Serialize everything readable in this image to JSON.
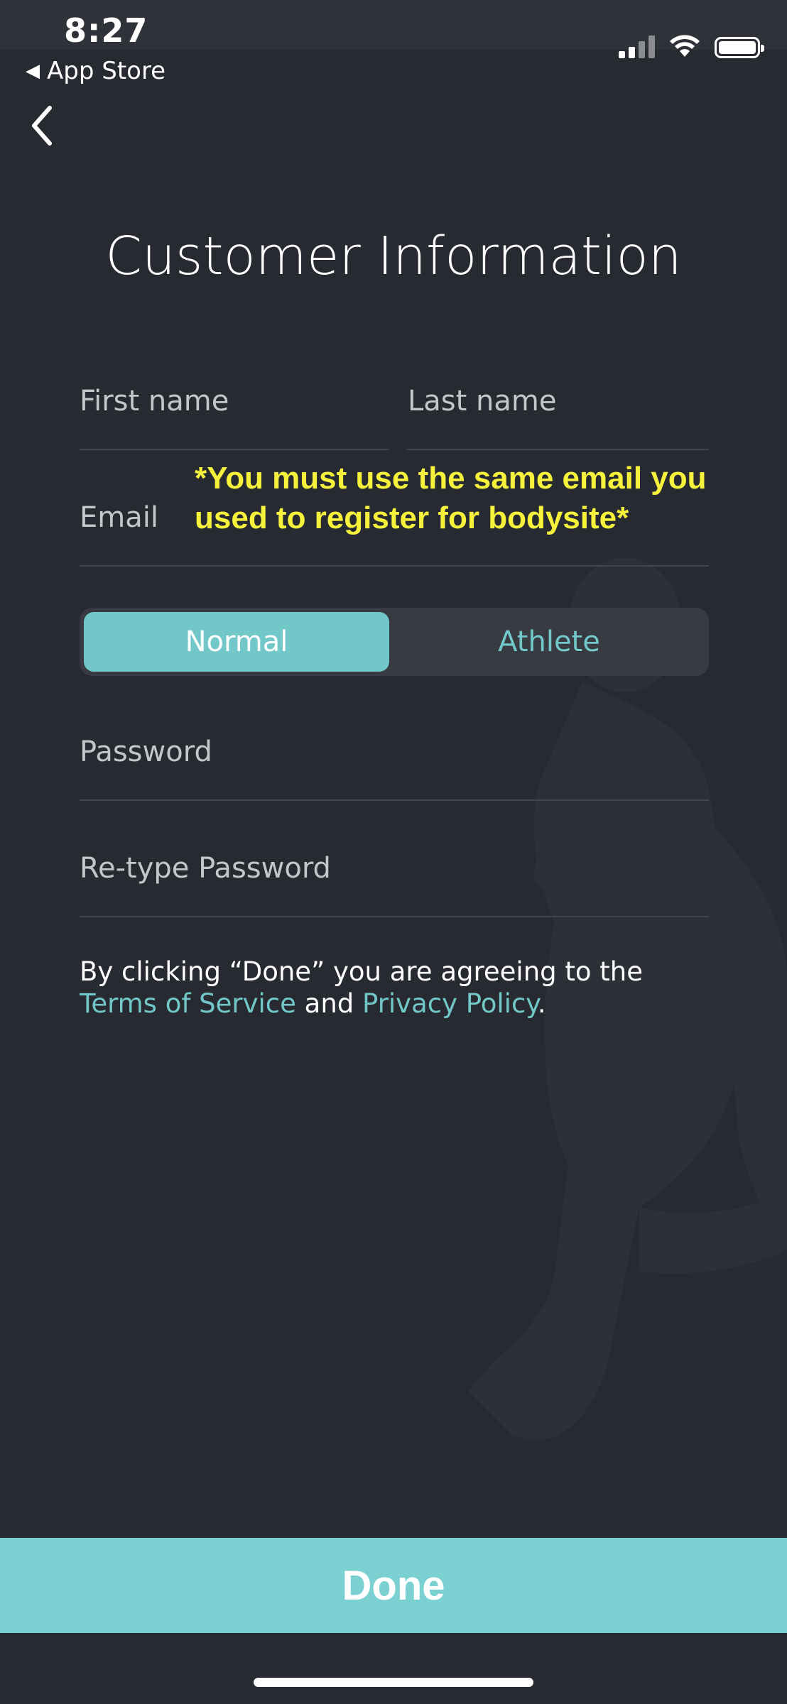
{
  "status_bar": {
    "time": "8:27",
    "back_app": "App Store",
    "icons": [
      "signal-icon",
      "wifi-icon",
      "battery-icon"
    ]
  },
  "nav": {
    "back_icon": "chevron-left-icon"
  },
  "page": {
    "title": "Customer Information"
  },
  "form": {
    "first_name_placeholder": "First name",
    "last_name_placeholder": "Last name",
    "email_placeholder": "Email",
    "email_warning": "*You must use the same email you used to register for bodysite*",
    "account_type": {
      "options": [
        "Normal",
        "Athlete"
      ],
      "selected": "Normal"
    },
    "password_placeholder": "Password",
    "retype_password_placeholder": "Re-type Password"
  },
  "legal": {
    "prefix": "By clicking “Done” you are agreeing to the ",
    "terms_link": "Terms of Service",
    "middle": " and ",
    "privacy_link": "Privacy Policy",
    "suffix": "."
  },
  "footer": {
    "done_label": "Done"
  },
  "colors": {
    "background": "#272a31",
    "accent": "#72c8c9",
    "done_button": "#7bd1d2",
    "warning": "#f6f13b"
  }
}
